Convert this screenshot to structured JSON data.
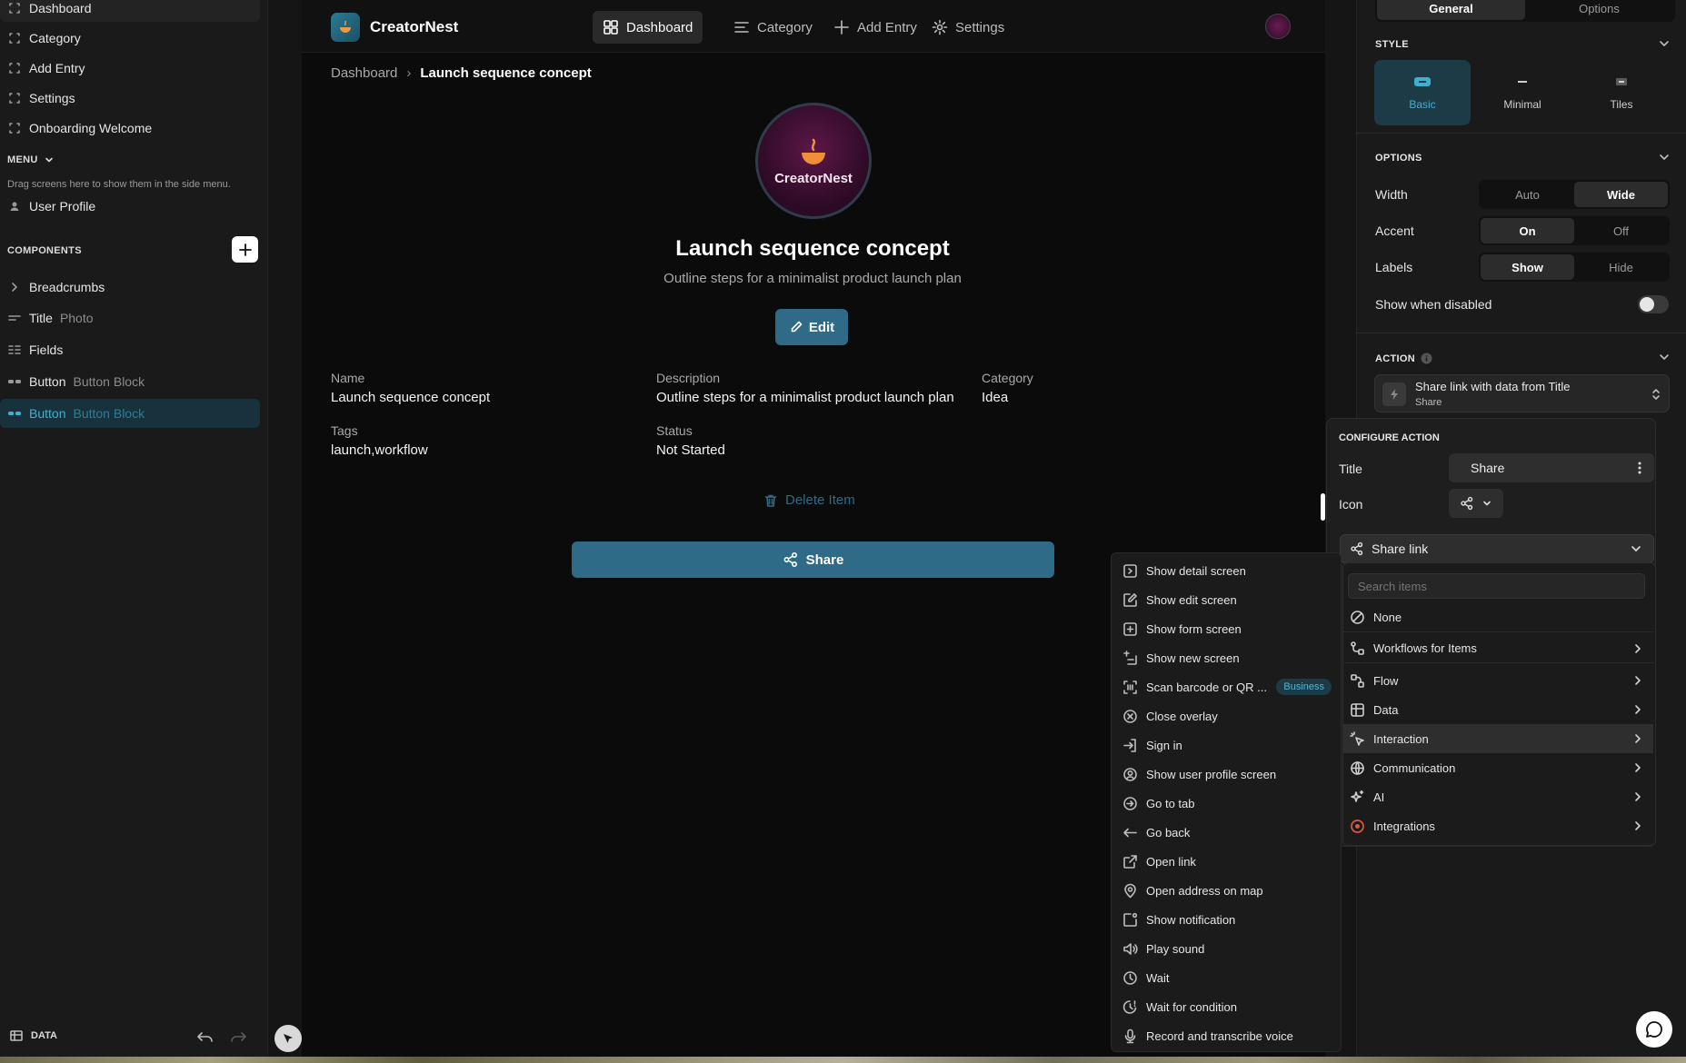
{
  "left_nav": {
    "items": [
      {
        "label": "Dashboard",
        "icon": "screen-icon"
      },
      {
        "label": "Category",
        "icon": "screen-icon"
      },
      {
        "label": "Add Entry",
        "icon": "screen-icon"
      },
      {
        "label": "Settings",
        "icon": "screen-icon"
      },
      {
        "label": "Onboarding Welcome",
        "icon": "screen-icon"
      }
    ],
    "menu_label": "MENU",
    "menu_hint": "Drag screens here to show them in the side menu.",
    "menu_items": [
      {
        "label": "User Profile",
        "icon": "user-icon"
      }
    ],
    "components_label": "COMPONENTS",
    "components": [
      {
        "label": "Breadcrumbs",
        "sub": ""
      },
      {
        "label": "Title",
        "sub": "Photo"
      },
      {
        "label": "Fields",
        "sub": ""
      },
      {
        "label": "Button",
        "sub": "Button Block"
      },
      {
        "label": "Button",
        "sub": "Button Block"
      }
    ],
    "data_label": "DATA"
  },
  "app": {
    "name": "CreatorNest",
    "logo_text": "CreatorNest",
    "tabs": [
      {
        "label": "Dashboard",
        "active": true
      },
      {
        "label": "Category",
        "active": false
      },
      {
        "label": "Add Entry",
        "active": false
      },
      {
        "label": "Settings",
        "active": false
      }
    ],
    "breadcrumb": {
      "parent": "Dashboard",
      "separator": "›",
      "current": "Launch sequence concept"
    },
    "title": "Launch sequence concept",
    "subtitle": "Outline steps for a minimalist product launch plan",
    "edit_label": "Edit",
    "fields": [
      {
        "label": "Name",
        "value": "Launch sequence concept"
      },
      {
        "label": "Description",
        "value": "Outline steps for a minimalist product launch plan"
      },
      {
        "label": "Category",
        "value": "Idea"
      },
      {
        "label": "Tags",
        "value": "launch,workflow"
      },
      {
        "label": "Status",
        "value": "Not Started"
      }
    ],
    "delete_label": "Delete Item",
    "share_label": "Share",
    "accent": "#2f6a86"
  },
  "right_panel": {
    "tabs": [
      "General",
      "Options"
    ],
    "style_label": "STYLE",
    "styles": [
      "Basic",
      "Minimal",
      "Tiles"
    ],
    "options_label": "OPTIONS",
    "width": {
      "label": "Width",
      "options": [
        "Auto",
        "Wide"
      ],
      "selected": "Wide"
    },
    "accent": {
      "label": "Accent",
      "options": [
        "On",
        "Off"
      ],
      "selected": "On"
    },
    "labels": {
      "label": "Labels",
      "options": [
        "Show",
        "Hide"
      ],
      "selected": "Show"
    },
    "show_when_disabled": "Show when disabled",
    "action_label": "ACTION",
    "action_title": "Share link with data from Title",
    "action_sub": "Share"
  },
  "configure_action": {
    "heading": "CONFIGURE ACTION",
    "title_label": "Title",
    "title_value": "Share",
    "icon_label": "Icon",
    "selected_action": "Share link",
    "search_placeholder": "Search items",
    "categories": [
      {
        "label": "None",
        "icon": "none-icon",
        "chevron": false
      },
      {
        "label": "Workflows for Items",
        "icon": "workflow-icon",
        "chevron": true
      },
      {
        "label": "Flow",
        "icon": "flow-icon",
        "chevron": true
      },
      {
        "label": "Data",
        "icon": "table-icon",
        "chevron": true
      },
      {
        "label": "Interaction",
        "icon": "cursor-icon",
        "chevron": true
      },
      {
        "label": "Communication",
        "icon": "globe-icon",
        "chevron": true
      },
      {
        "label": "AI",
        "icon": "sparkle-icon",
        "chevron": true
      },
      {
        "label": "Integrations",
        "icon": "integration-icon",
        "chevron": true
      }
    ]
  },
  "interaction_menu": {
    "items": [
      {
        "label": "Show detail screen",
        "badge": ""
      },
      {
        "label": "Show edit screen",
        "badge": ""
      },
      {
        "label": "Show form screen",
        "badge": ""
      },
      {
        "label": "Show new screen",
        "badge": ""
      },
      {
        "label": "Scan barcode or QR ...",
        "badge": "Business"
      },
      {
        "label": "Close overlay",
        "badge": ""
      },
      {
        "label": "Sign in",
        "badge": ""
      },
      {
        "label": "Show user profile screen",
        "badge": ""
      },
      {
        "label": "Go to tab",
        "badge": ""
      },
      {
        "label": "Go back",
        "badge": ""
      },
      {
        "label": "Open link",
        "badge": ""
      },
      {
        "label": "Open address on map",
        "badge": ""
      },
      {
        "label": "Show notification",
        "badge": ""
      },
      {
        "label": "Play sound",
        "badge": ""
      },
      {
        "label": "Wait",
        "badge": ""
      },
      {
        "label": "Wait for condition",
        "badge": ""
      },
      {
        "label": "Record and transcribe voice",
        "badge": ""
      }
    ]
  }
}
